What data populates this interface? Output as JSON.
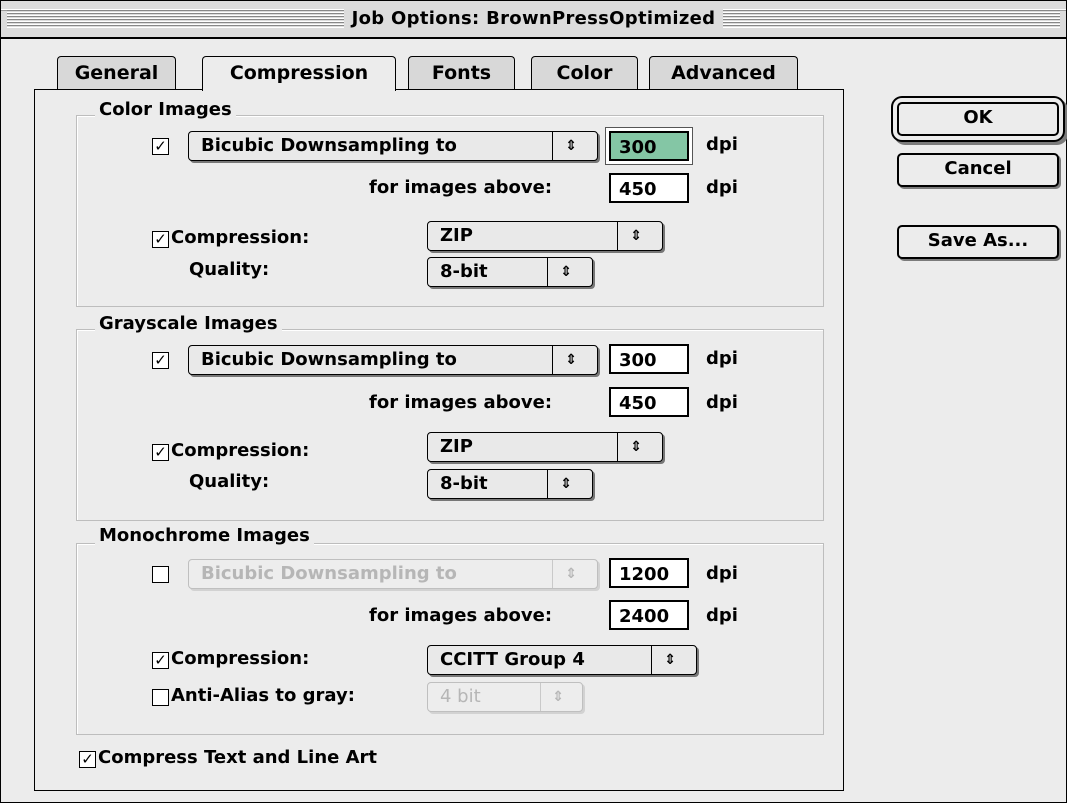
{
  "window": {
    "title": "Job Options: BrownPressOptimized"
  },
  "tabs": [
    "General",
    "Compression",
    "Fonts",
    "Color",
    "Advanced"
  ],
  "selected_tab": "Compression",
  "buttons": {
    "ok": "OK",
    "cancel": "Cancel",
    "save_as": "Save As..."
  },
  "color_images": {
    "title": "Color Images",
    "downsample_checked": true,
    "downsample_method": "Bicubic Downsampling to",
    "resolution": "300",
    "resolution_unit": "dpi",
    "above_label": "for images above:",
    "above_value": "450",
    "above_unit": "dpi",
    "compression_checked": true,
    "compression_label": "Compression:",
    "compression_value": "ZIP",
    "quality_label": "Quality:",
    "quality_value": "8-bit"
  },
  "grayscale_images": {
    "title": "Grayscale Images",
    "downsample_checked": true,
    "downsample_method": "Bicubic Downsampling to",
    "resolution": "300",
    "resolution_unit": "dpi",
    "above_label": "for images above:",
    "above_value": "450",
    "above_unit": "dpi",
    "compression_checked": true,
    "compression_label": "Compression:",
    "compression_value": "ZIP",
    "quality_label": "Quality:",
    "quality_value": "8-bit"
  },
  "monochrome_images": {
    "title": "Monochrome Images",
    "downsample_checked": false,
    "downsample_method": "Bicubic Downsampling to",
    "resolution": "1200",
    "resolution_unit": "dpi",
    "above_label": "for images above:",
    "above_value": "2400",
    "above_unit": "dpi",
    "compression_checked": true,
    "compression_label": "Compression:",
    "compression_value": "CCITT Group 4",
    "antialias_checked": false,
    "antialias_label": "Anti-Alias to gray:",
    "antialias_value": "4 bit"
  },
  "compress_text": {
    "checked": true,
    "label": "Compress Text and Line Art"
  },
  "glyphs": {
    "check": "✓",
    "updown": "⇕"
  },
  "colors": {
    "highlight_field": "#84c6a5",
    "disabled_text": "#b6b6b6"
  }
}
